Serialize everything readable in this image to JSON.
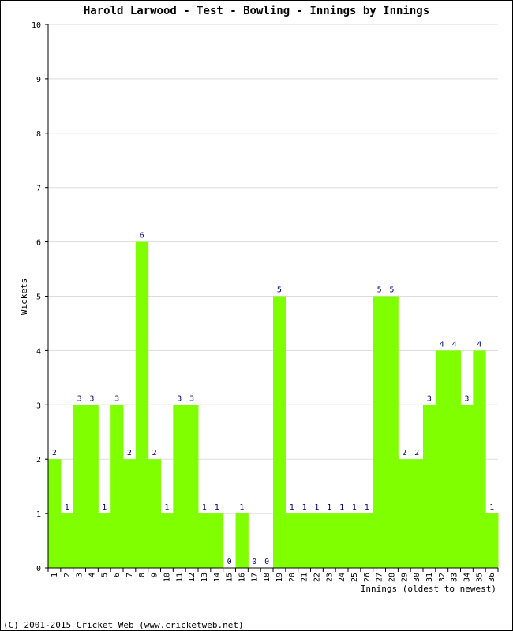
{
  "chart_data": {
    "type": "bar",
    "title": "Harold Larwood - Test - Bowling - Innings by Innings",
    "xlabel": "Innings (oldest to newest)",
    "ylabel": "Wickets",
    "ylim": [
      0,
      10
    ],
    "yticks": [
      0,
      1,
      2,
      3,
      4,
      5,
      6,
      7,
      8,
      9,
      10
    ],
    "grid": true,
    "categories": [
      "1",
      "2",
      "3",
      "4",
      "5",
      "6",
      "7",
      "8",
      "9",
      "10",
      "11",
      "12",
      "13",
      "14",
      "15",
      "16",
      "17",
      "18",
      "19",
      "20",
      "21",
      "22",
      "23",
      "24",
      "25",
      "26",
      "27",
      "28",
      "29",
      "30",
      "31",
      "32",
      "33",
      "34",
      "35",
      "36"
    ],
    "values": [
      2,
      1,
      3,
      3,
      1,
      3,
      2,
      6,
      2,
      1,
      3,
      3,
      1,
      1,
      0,
      1,
      0,
      0,
      5,
      1,
      1,
      1,
      1,
      1,
      1,
      1,
      5,
      5,
      2,
      2,
      3,
      4,
      4,
      3,
      4,
      1
    ],
    "bar_color": "#80ff00",
    "label_color": "#000080"
  },
  "footer": "(C) 2001-2015 Cricket Web (www.cricketweb.net)"
}
